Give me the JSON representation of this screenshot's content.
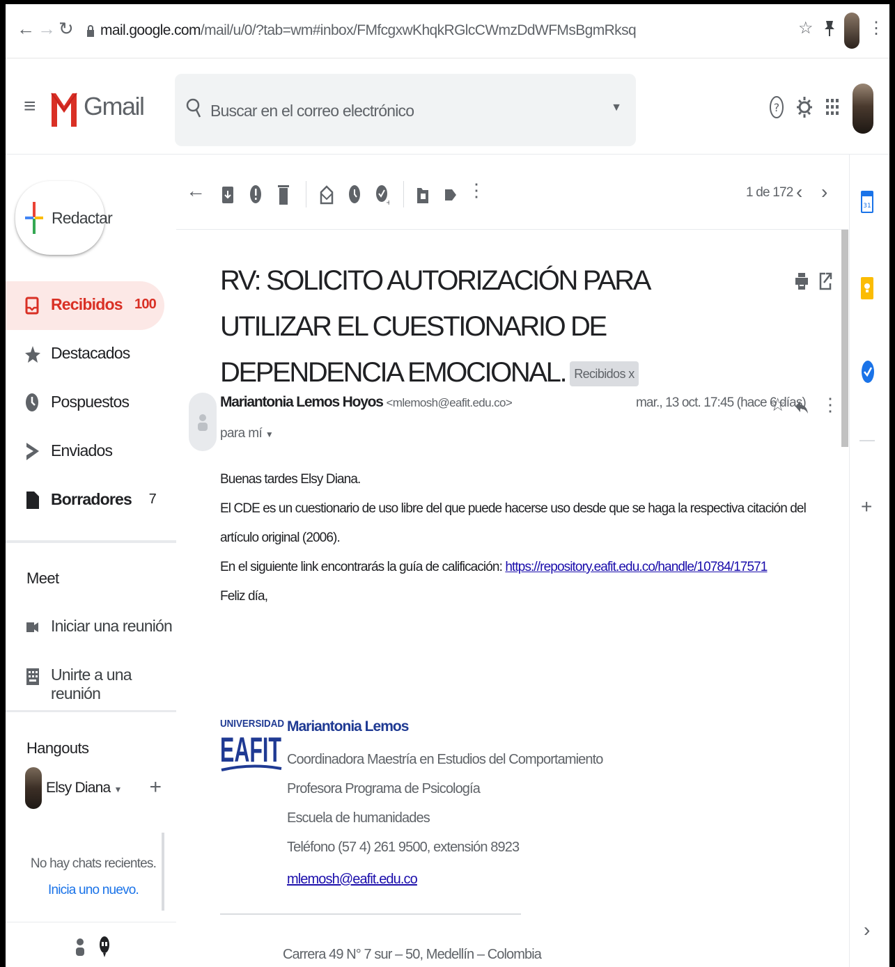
{
  "browser": {
    "url_host": "mail.google.com",
    "url_path": "/mail/u/0/?tab=wm#inbox/FMfcgxwKhqkRGlcCWmzDdWFMsBgmRksq"
  },
  "header": {
    "app_name": "Gmail",
    "search_placeholder": "Buscar en el correo electrónico"
  },
  "sidebar": {
    "compose_label": "Redactar",
    "items": [
      {
        "label": "Recibidos",
        "count": "100"
      },
      {
        "label": "Destacados",
        "count": ""
      },
      {
        "label": "Pospuestos",
        "count": ""
      },
      {
        "label": "Enviados",
        "count": ""
      },
      {
        "label": "Borradores",
        "count": "7"
      }
    ],
    "meet": {
      "title": "Meet",
      "start": "Iniciar una reunión",
      "join": "Unirte a una reunión"
    },
    "hangouts": {
      "title": "Hangouts",
      "user_name": "Elsy Diana",
      "no_chats": "No hay chats recientes.",
      "start_new": "Inicia uno nuevo."
    }
  },
  "toolbar": {
    "pager": "1 de 172"
  },
  "message": {
    "subject": "RV: SOLICITO AUTORIZACIÓN PARA UTILIZAR EL CUESTIONARIO DE DEPENDENCIA EMOCIONAL.",
    "label_chip": "Recibidos x",
    "sender_name": "Mariantonia Lemos Hoyos",
    "sender_email": "<mlemosh@eafit.edu.co>",
    "date": "mar., 13 oct. 17:45 (hace 6 días)",
    "to": "para mí",
    "body": {
      "greeting": "Buenas tardes Elsy Diana.",
      "line1": "El CDE es un cuestionario de uso libre del que puede hacerse uso desde que se haga la respectiva citación del artículo original (2006).",
      "line2_prefix": "En el siguiente link encontrarás la guía de calificación: ",
      "link": "https://repository.eafit.edu.co/handle/10784/17571",
      "closing": "Feliz día,"
    },
    "signature": {
      "logo_top": "UNIVERSIDAD",
      "logo_main": "EAFIT",
      "name": "Mariantonia Lemos",
      "title1": "Coordinadora Maestría en Estudios del Comportamiento",
      "title2": "Profesora Programa de Psicología",
      "school": "Escuela de humanidades",
      "phone": "Teléfono (57 4) 261 9500, extensión 8923",
      "email": "mlemosh@eafit.edu.co",
      "address": "Carrera 49 N° 7 sur – 50, Medellín – Colombia"
    }
  },
  "colors": {
    "accent_red": "#d93025",
    "link_blue": "#1a0dab",
    "eafit_blue": "#1f3a93"
  }
}
